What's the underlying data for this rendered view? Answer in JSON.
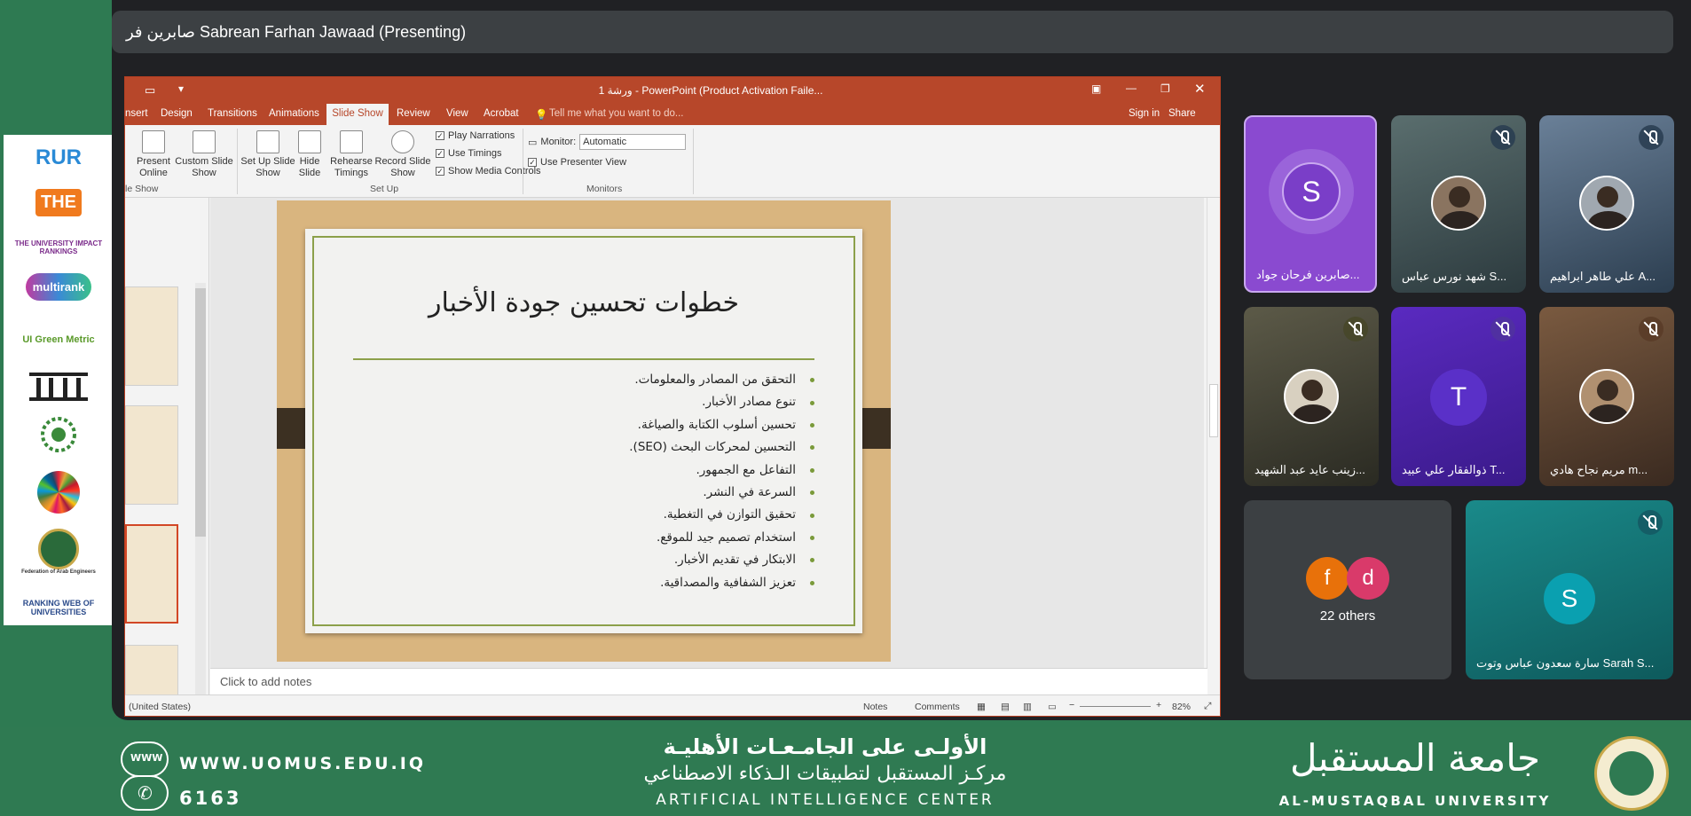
{
  "presenter": {
    "label": "صابرين فر Sabrean Farhan Jawaad (Presenting)"
  },
  "ppt": {
    "window_title": "ورشة 1 - PowerPoint (Product Activation Faile...",
    "menu": [
      "nsert",
      "Design",
      "Transitions",
      "Animations",
      "Slide Show",
      "Review",
      "View",
      "Acrobat"
    ],
    "tell_me": "Tell me what you want to do...",
    "sign_in": "Sign in",
    "share": "Share",
    "ribbon": {
      "present_online": "Present Online",
      "custom_slide_show": "Custom Slide Show",
      "set_up_slide_show": "Set Up Slide Show",
      "hide_slide": "Hide Slide",
      "rehearse_timings": "Rehearse Timings",
      "record_slide_show": "Record Slide Show",
      "play_narrations": "Play Narrations",
      "use_timings": "Use Timings",
      "show_media_controls": "Show Media Controls",
      "monitor_label": "Monitor:",
      "monitor_value": "Automatic",
      "use_presenter_view": "Use Presenter View",
      "group_slideshow": "le Show",
      "group_setup": "Set Up",
      "group_monitors": "Monitors"
    },
    "slide": {
      "title": "خطوات تحسين جودة الأخبار",
      "bullets": [
        "التحقق من المصادر والمعلومات.",
        "تنوع مصادر الأخبار.",
        "تحسين أسلوب الكتابة والصياغة.",
        "التحسين لمحركات البحث (SEO).",
        "التفاعل مع الجمهور.",
        "السرعة في النشر.",
        "تحقيق التوازن في التغطية.",
        "استخدام تصميم جيد للموقع.",
        "الابتكار في تقديم الأخبار.",
        "تعزيز الشفافية والمصداقية."
      ]
    },
    "notes_placeholder": "Click to add notes",
    "status": {
      "language": "(United States)",
      "notes": "Notes",
      "comments": "Comments",
      "zoom": "82%"
    }
  },
  "participants": [
    {
      "name": "صابرين فرحان جواد...",
      "initial": "S",
      "color": "#7a3ec8"
    },
    {
      "name": "شهد نورس عباس S...",
      "muted": true
    },
    {
      "name": "علي طاهر ابراهيم A...",
      "muted": true
    },
    {
      "name": "زينب عايد عبد الشهيد...",
      "muted": true
    },
    {
      "name": "ذوالفقار علي عبيد T...",
      "initial": "T",
      "muted": true
    },
    {
      "name": "مريم نجاح هادي m...",
      "muted": true
    },
    {
      "name": "22 others",
      "initials": [
        "f",
        "d"
      ]
    },
    {
      "name": "سارة سعدون عباس وتوت Sarah S...",
      "initial": "S",
      "muted": true
    }
  ],
  "rankings": [
    "RUR",
    "THE",
    "THE UNIVERSITY IMPACT RANKINGS",
    "multirank",
    "UI Green Metric",
    "Federation of Arab Engineers",
    "RANKING WEB OF UNIVERSITIES"
  ],
  "footer": {
    "website": "WWW.UOMUS.EDU.IQ",
    "phone": "6163",
    "line1": "الأولـى على الجامـعـات الأهليـة",
    "line2": "مركـز المستقبل لتطبيقات الـذكاء الاصطناعي",
    "line3": "ARTIFICIAL INTELLIGENCE CENTER",
    "uni_ar": "جامعة المستقبل",
    "uni_en": "AL-MUSTAQBAL UNIVERSITY"
  },
  "colors": {
    "ppt_accent": "#b7472a",
    "meet_bg": "#202124",
    "footer_green": "#2f7a52"
  }
}
